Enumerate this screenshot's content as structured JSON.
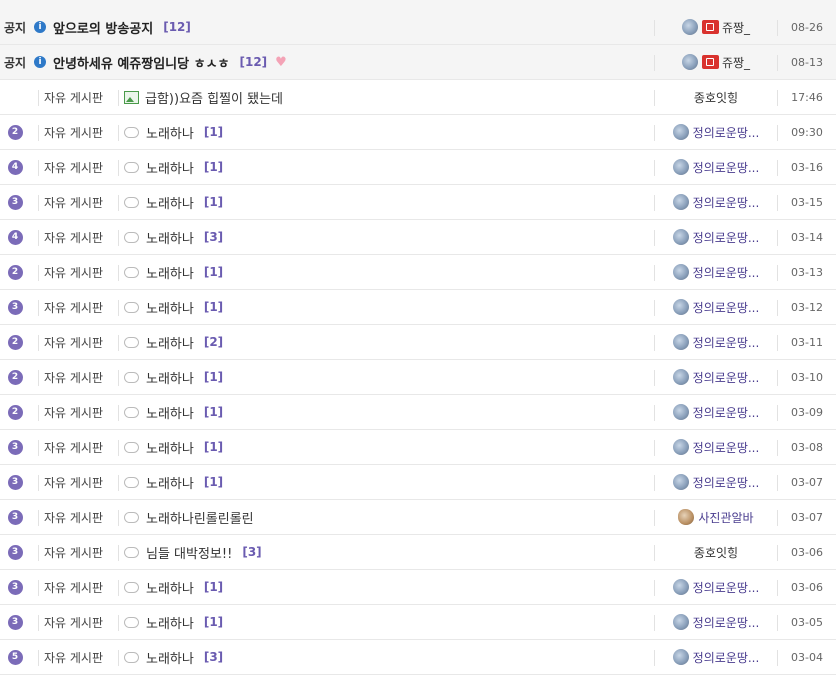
{
  "notices": [
    {
      "label": "공지",
      "title": "앞으로의 방송공지",
      "comments": "[12]",
      "author": "쥬짱_",
      "date": "08-26",
      "heart": false
    },
    {
      "label": "공지",
      "title": "안녕하세유 예쥬짱임니당 ㅎㅅㅎ",
      "comments": "[12]",
      "author": "쥬짱_",
      "date": "08-13",
      "heart": true
    }
  ],
  "posts": [
    {
      "badge": "",
      "category": "자유 게시판",
      "icon": "image-icon",
      "title": "급함))요즘 힙찔이 됐는데",
      "comments": "",
      "author": "종호잇힝",
      "avatar": false,
      "date": "17:46"
    },
    {
      "badge": "2",
      "category": "자유 게시판",
      "icon": "comment-bubble-icon",
      "title": "노래하나",
      "comments": "[1]",
      "author": "정의로운땅...",
      "avatar": true,
      "date": "09:30"
    },
    {
      "badge": "4",
      "category": "자유 게시판",
      "icon": "comment-bubble-icon",
      "title": "노래하나",
      "comments": "[1]",
      "author": "정의로운땅...",
      "avatar": true,
      "date": "03-16"
    },
    {
      "badge": "3",
      "category": "자유 게시판",
      "icon": "comment-bubble-icon",
      "title": "노래하나",
      "comments": "[1]",
      "author": "정의로운땅...",
      "avatar": true,
      "date": "03-15"
    },
    {
      "badge": "4",
      "category": "자유 게시판",
      "icon": "comment-bubble-icon",
      "title": "노래하나",
      "comments": "[3]",
      "author": "정의로운땅...",
      "avatar": true,
      "date": "03-14"
    },
    {
      "badge": "2",
      "category": "자유 게시판",
      "icon": "comment-bubble-icon",
      "title": "노래하나",
      "comments": "[1]",
      "author": "정의로운땅...",
      "avatar": true,
      "date": "03-13"
    },
    {
      "badge": "3",
      "category": "자유 게시판",
      "icon": "comment-bubble-icon",
      "title": "노래하나",
      "comments": "[1]",
      "author": "정의로운땅...",
      "avatar": true,
      "date": "03-12"
    },
    {
      "badge": "2",
      "category": "자유 게시판",
      "icon": "comment-bubble-icon",
      "title": "노래하나",
      "comments": "[2]",
      "author": "정의로운땅...",
      "avatar": true,
      "date": "03-11"
    },
    {
      "badge": "2",
      "category": "자유 게시판",
      "icon": "comment-bubble-icon",
      "title": "노래하나",
      "comments": "[1]",
      "author": "정의로운땅...",
      "avatar": true,
      "date": "03-10"
    },
    {
      "badge": "2",
      "category": "자유 게시판",
      "icon": "comment-bubble-icon",
      "title": "노래하나",
      "comments": "[1]",
      "author": "정의로운땅...",
      "avatar": true,
      "date": "03-09"
    },
    {
      "badge": "3",
      "category": "자유 게시판",
      "icon": "comment-bubble-icon",
      "title": "노래하나",
      "comments": "[1]",
      "author": "정의로운땅...",
      "avatar": true,
      "date": "03-08"
    },
    {
      "badge": "3",
      "category": "자유 게시판",
      "icon": "comment-bubble-icon",
      "title": "노래하나",
      "comments": "[1]",
      "author": "정의로운땅...",
      "avatar": true,
      "date": "03-07"
    },
    {
      "badge": "3",
      "category": "자유 게시판",
      "icon": "comment-bubble-icon",
      "title": "노래하나린롤린롤린",
      "comments": "",
      "author": "사진관알바",
      "avatar": "shell",
      "date": "03-07"
    },
    {
      "badge": "3",
      "category": "자유 게시판",
      "icon": "comment-bubble-icon",
      "title": "님들 대박정보!!",
      "comments": "[3]",
      "author": "종호잇힝",
      "avatar": false,
      "date": "03-06"
    },
    {
      "badge": "3",
      "category": "자유 게시판",
      "icon": "comment-bubble-icon",
      "title": "노래하나",
      "comments": "[1]",
      "author": "정의로운땅...",
      "avatar": true,
      "date": "03-06"
    },
    {
      "badge": "3",
      "category": "자유 게시판",
      "icon": "comment-bubble-icon",
      "title": "노래하나",
      "comments": "[1]",
      "author": "정의로운땅...",
      "avatar": true,
      "date": "03-05"
    },
    {
      "badge": "5",
      "category": "자유 게시판",
      "icon": "comment-bubble-icon",
      "title": "노래하나",
      "comments": "[3]",
      "author": "정의로운땅...",
      "avatar": true,
      "date": "03-04"
    }
  ],
  "colors": {
    "badge": "#7b6bb8",
    "comment_count": "#6a5bb0",
    "info_icon": "#2e79c8",
    "live_icon": "#d9322e"
  }
}
